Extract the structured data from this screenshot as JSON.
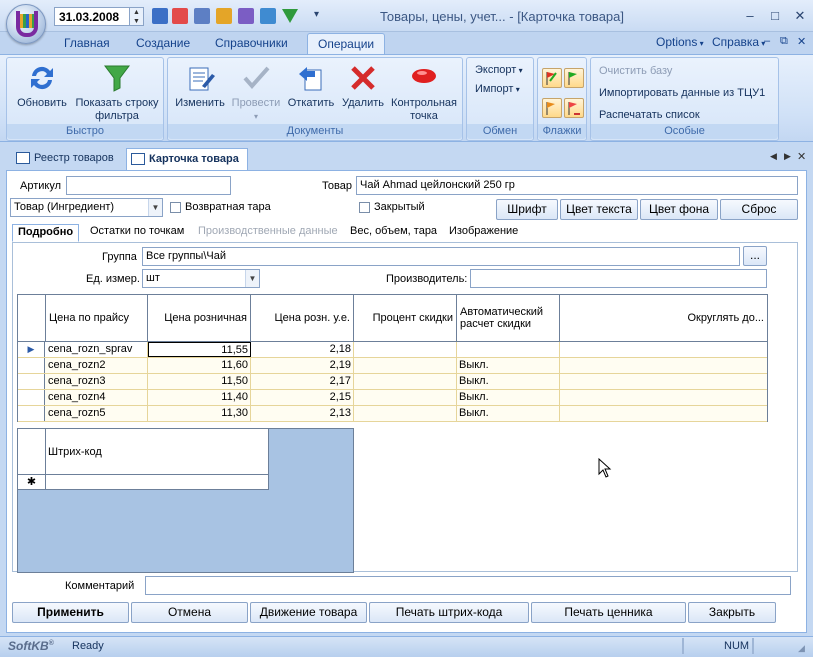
{
  "titlebar": {
    "date": "31.03.2008",
    "window_title": "Товары, цены, учет... - [Карточка товара]",
    "minimize": "–",
    "maximize": "□",
    "close": "✕"
  },
  "ribbon_tabs": [
    "Главная",
    "Создание",
    "Справочники",
    "Операции"
  ],
  "ribbon_right": {
    "options": "Options",
    "help": "Справка"
  },
  "groups": {
    "quick": {
      "label": "Быстро",
      "refresh": "Обновить",
      "filter": "Показать строку фильтра"
    },
    "documents": {
      "label": "Документы",
      "edit": "Изменить",
      "post": "Провести",
      "rollback": "Откатить",
      "delete": "Удалить",
      "checkpoint": "Контрольная точка"
    },
    "exchange": {
      "label": "Обмен",
      "export": "Экспорт",
      "import": "Импорт"
    },
    "flags": {
      "label": "Флажки"
    },
    "special": {
      "label": "Особые",
      "clear_db": "Очистить базу",
      "import_tcu": "Импортировать данные из ТЦУ1",
      "print_list": "Распечатать список"
    }
  },
  "doc_tabs": [
    "Реестр товаров",
    "Карточка товара"
  ],
  "form": {
    "article_label": "Артикул",
    "article_value": "",
    "product_label": "Товар",
    "product_value": "Чай Ahmad цейлонский 250 гр",
    "type_value": "Товар (Ингредиент)",
    "returnable_label": "Возвратная тара",
    "closed_label": "Закрытый",
    "font_btn": "Шрифт",
    "text_color_btn": "Цвет текста",
    "bg_color_btn": "Цвет фона",
    "reset_btn": "Сброс"
  },
  "subtabs": [
    "Подробно",
    "Остатки по точкам",
    "Производственные данные",
    "Вес, объем, тара",
    "Изображение"
  ],
  "detail": {
    "group_label": "Группа",
    "group_value": "Все группы\\Чай",
    "group_btn": "...",
    "unit_label": "Ед. измер.",
    "unit_value": "шт",
    "manufacturer_label": "Производитель:",
    "manufacturer_value": ""
  },
  "price_grid": {
    "columns": [
      "Цена по прайсу",
      "Цена розничная",
      "Цена розн. у.е.",
      "Процент скидки",
      "Автоматический расчет скидки",
      "Округлять до..."
    ],
    "rows": [
      {
        "name": "cena_rozn_sprav",
        "retail": "11,55",
        "ue": "2,18",
        "percent": "",
        "auto": "",
        "round": ""
      },
      {
        "name": "cena_rozn2",
        "retail": "11,60",
        "ue": "2,19",
        "percent": "",
        "auto": "Выкл.",
        "round": ""
      },
      {
        "name": "cena_rozn3",
        "retail": "11,50",
        "ue": "2,17",
        "percent": "",
        "auto": "Выкл.",
        "round": ""
      },
      {
        "name": "cena_rozn4",
        "retail": "11,40",
        "ue": "2,15",
        "percent": "",
        "auto": "Выкл.",
        "round": ""
      },
      {
        "name": "cena_rozn5",
        "retail": "11,30",
        "ue": "2,13",
        "percent": "",
        "auto": "Выкл.",
        "round": ""
      }
    ],
    "current_marker": "▶"
  },
  "barcode_grid": {
    "column": "Штрих-код",
    "new_marker": "✱"
  },
  "comment_label": "Комментарий",
  "comment_value": "",
  "bottom_buttons": [
    "Применить",
    "Отмена",
    "Движение товара",
    "Печать штрих-кода",
    "Печать ценника",
    "Закрыть"
  ],
  "status": {
    "brand": "SoftKB",
    "text": "Ready",
    "num": "NUM"
  }
}
